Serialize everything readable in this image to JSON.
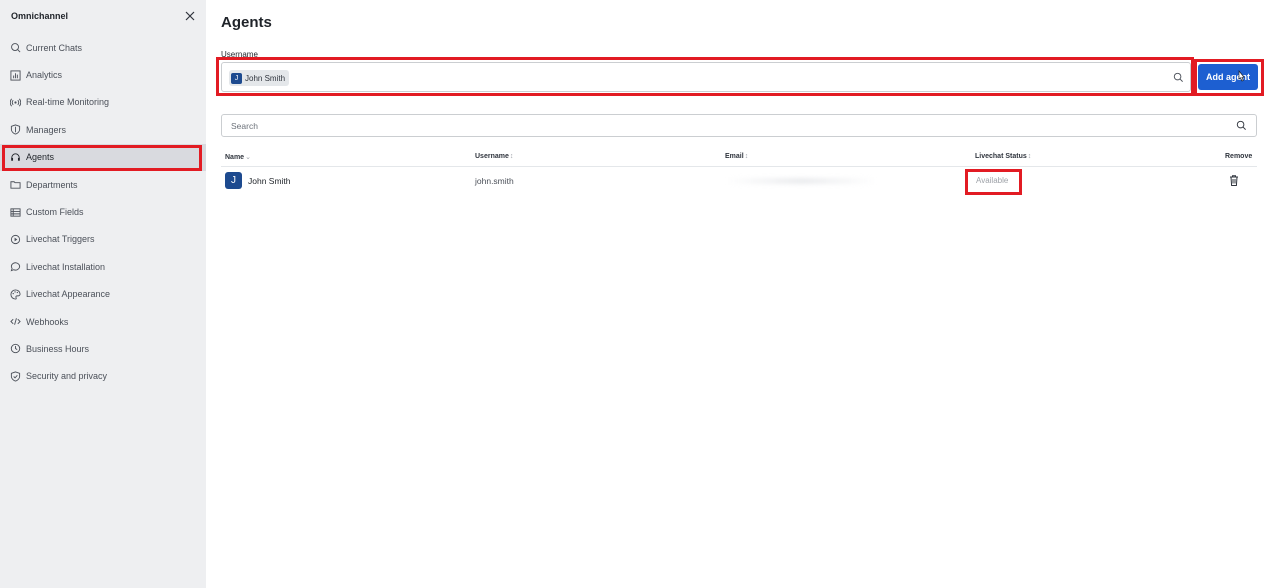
{
  "sidebar": {
    "title": "Omnichannel",
    "items": [
      {
        "label": "Current Chats",
        "icon": "chat-search-icon"
      },
      {
        "label": "Analytics",
        "icon": "bar-chart-icon"
      },
      {
        "label": "Real-time Monitoring",
        "icon": "broadcast-icon"
      },
      {
        "label": "Managers",
        "icon": "shield-icon"
      },
      {
        "label": "Agents",
        "icon": "headset-icon",
        "active": true
      },
      {
        "label": "Departments",
        "icon": "folder-icon"
      },
      {
        "label": "Custom Fields",
        "icon": "list-icon"
      },
      {
        "label": "Livechat Triggers",
        "icon": "trigger-icon"
      },
      {
        "label": "Livechat Installation",
        "icon": "chat-bubble-icon"
      },
      {
        "label": "Livechat Appearance",
        "icon": "palette-icon"
      },
      {
        "label": "Webhooks",
        "icon": "code-icon"
      },
      {
        "label": "Business Hours",
        "icon": "clock-icon"
      },
      {
        "label": "Security and privacy",
        "icon": "shield-check-icon"
      }
    ]
  },
  "main": {
    "title": "Agents",
    "username_label": "Username",
    "selected_user": {
      "initial": "J",
      "name": "John Smith"
    },
    "add_button_label": "Add agent",
    "search_placeholder": "Search",
    "columns": {
      "name": "Name",
      "username": "Username",
      "email": "Email",
      "status": "Livechat Status",
      "remove": "Remove"
    },
    "rows": [
      {
        "initial": "J",
        "name": "John Smith",
        "username": "john.smith",
        "email": "",
        "status": "Available"
      }
    ]
  },
  "colors": {
    "accent": "#1d5fd1",
    "highlight": "#e21b23",
    "avatar": "#1d4a8f",
    "sidebar_bg": "#eeeff1"
  }
}
